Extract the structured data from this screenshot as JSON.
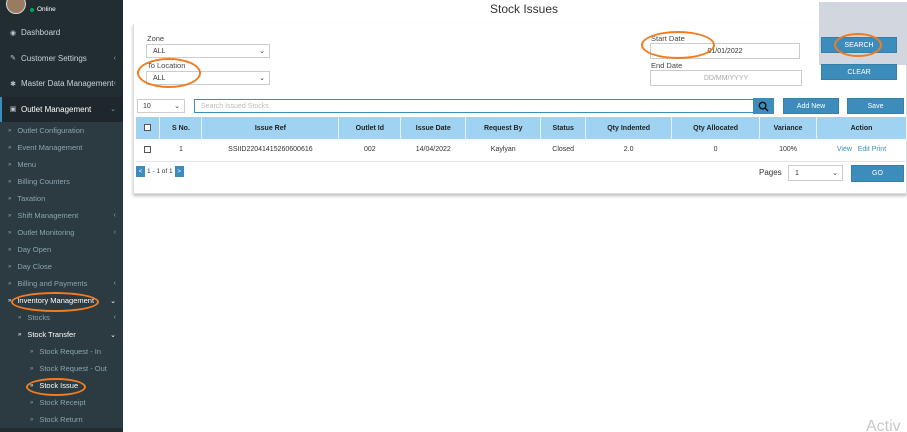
{
  "sidebar": {
    "status": "Online",
    "items": [
      {
        "label": "Dashboard",
        "icon": "dashboard-icon",
        "glyph": "◉"
      },
      {
        "label": "Customer Settings",
        "icon": "wrench-icon",
        "glyph": "✎"
      },
      {
        "label": "Master Data Management",
        "icon": "gear-icon",
        "glyph": "✱"
      },
      {
        "label": "Outlet Management",
        "icon": "folder-icon",
        "glyph": "▣"
      }
    ],
    "outlet_sub": [
      "Outlet Configuration",
      "Event Management",
      "Menu",
      "Billing Counters",
      "Taxation",
      "Shift Management",
      "Outlet Monitoring",
      "Day Open",
      "Day Close",
      "Billing and Payments",
      "Inventory Management"
    ],
    "inventory_sub": [
      "Stocks",
      "Stock Transfer"
    ],
    "transfer_sub": [
      "Stock Request - In",
      "Stock Request - Out",
      "Stock Issue",
      "Stock Receipt",
      "Stock Return"
    ]
  },
  "page": {
    "title": "Stock Issues"
  },
  "filters": {
    "zone_label": "Zone",
    "zone_value": "ALL",
    "to_location_label": "To Location",
    "to_location_value": "ALL",
    "start_date_label": "Start Date",
    "start_date_value": "01/01/2022",
    "end_date_label": "End Date",
    "end_date_placeholder": "DD/MM/YYYY",
    "search_label": "SEARCH",
    "clear_label": "CLEAR"
  },
  "toolbar": {
    "page_length": "10",
    "search_placeholder": "Search Issued Stocks",
    "add_new_label": "Add New",
    "save_label": "Save"
  },
  "table": {
    "columns": [
      "S No.",
      "Issue Ref",
      "Outlet Id",
      "Issue Date",
      "Request By",
      "Status",
      "Qty Indented",
      "Qty Allocated",
      "Variance",
      "Action"
    ],
    "rows": [
      {
        "sno": "1",
        "issue_ref": "SSIID22041415260600616",
        "outlet_id": "002",
        "issue_date": "14/04/2022",
        "request_by": "Kaylyan",
        "status": "Closed",
        "qty_indented": "2.0",
        "qty_allocated": "0",
        "variance": "100%",
        "actions": [
          "View",
          "Edit",
          "Print"
        ]
      }
    ]
  },
  "pagination": {
    "prev": "<",
    "info": "1 - 1 of 1",
    "next": ">",
    "pages_label": "Pages",
    "page_value": "1",
    "go_label": "GO"
  },
  "watermark": "Activ",
  "colors": {
    "primary": "#3c8dbc",
    "sidebar": "#222d32",
    "header": "#9fd3f1",
    "highlight": "#f07c22"
  }
}
